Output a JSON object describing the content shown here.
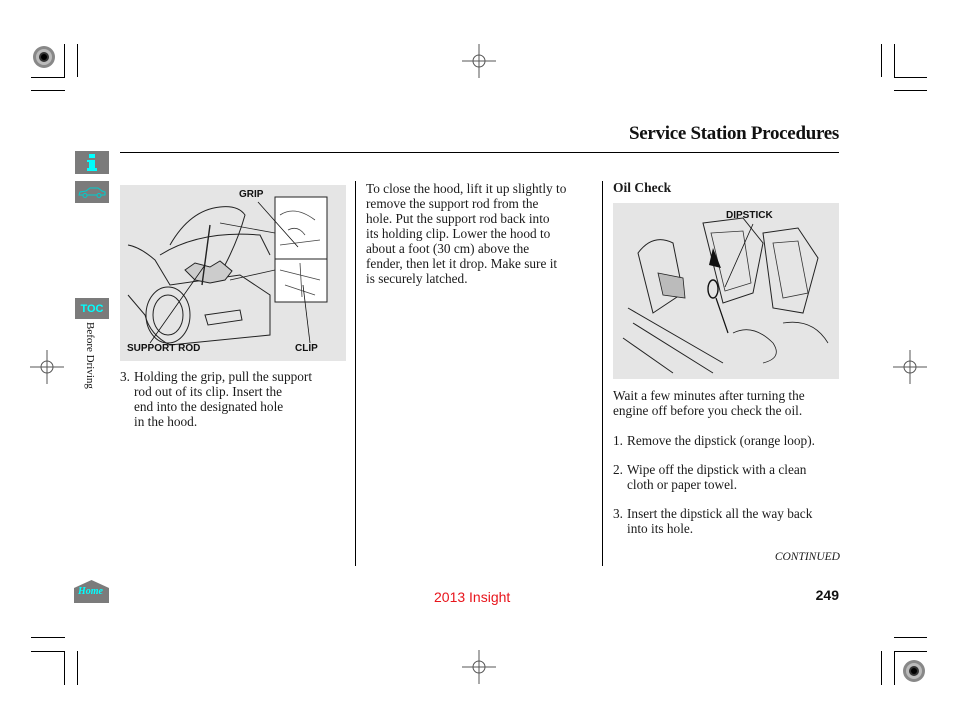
{
  "header": {
    "title": "Service Station Procedures"
  },
  "side_nav": {
    "info_icon": "info-icon",
    "car_icon": "car-icon",
    "toc_label": "TOC",
    "section_label": "Before Driving",
    "home_label": "Home",
    "accent_color": "#00ffff",
    "button_color": "#7b7b7b"
  },
  "left_column": {
    "figure": {
      "labels": {
        "grip": "GRIP",
        "support_rod": "SUPPORT ROD",
        "clip": "CLIP"
      }
    },
    "step": {
      "number": "3.",
      "lines": [
        "Holding the grip, pull the support",
        "rod out of its clip. Insert the",
        "end into the designated hole",
        "in the hood."
      ]
    }
  },
  "middle_column": {
    "lines": [
      "To close the hood, lift it up slightly to",
      "remove the support rod from the",
      "hole. Put the support rod back into",
      "its holding clip. Lower the hood to",
      "about a foot (30 cm) above the",
      "fender, then let it drop. Make sure it",
      "is securely latched."
    ]
  },
  "right_column": {
    "heading": "Oil Check",
    "figure": {
      "labels": {
        "dipstick": "DIPSTICK"
      }
    },
    "intro_lines": [
      "Wait a few minutes after turning the",
      "engine off before you check the oil."
    ],
    "steps": [
      {
        "number": "1.",
        "lines": [
          "Remove the dipstick (orange loop)."
        ]
      },
      {
        "number": "2.",
        "lines": [
          "Wipe off the dipstick with a clean",
          "cloth or paper towel."
        ]
      },
      {
        "number": "3.",
        "lines": [
          "Insert the dipstick all the way back",
          "into its hole."
        ]
      }
    ],
    "continued": "CONTINUED"
  },
  "footer": {
    "model": "2013 Insight",
    "page_number": "249",
    "model_color": "#e8141b"
  }
}
